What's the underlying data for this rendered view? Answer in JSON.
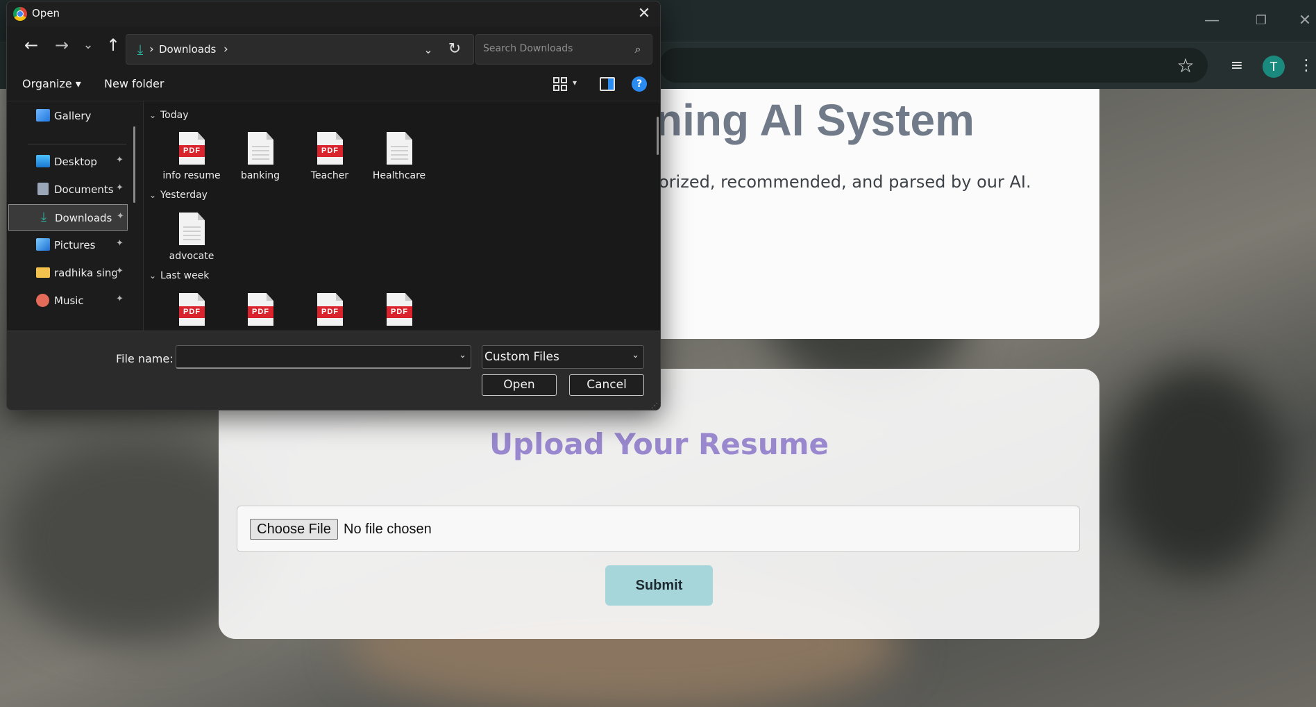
{
  "browser": {
    "window_controls": {
      "minimize": "—",
      "restore": "❐",
      "close": "✕"
    },
    "toolbar_icons": [
      "star-icon",
      "reading-list-icon",
      "profile-avatar",
      "menu-icon"
    ],
    "avatar_letter": "T",
    "avatar_color": "#1a8a7e"
  },
  "page": {
    "hero_title": "ning AI System",
    "hero_subtitle": "orized, recommended, and parsed by our AI.",
    "upload_title": "Upload Your Resume",
    "choose_file_label": "Choose File",
    "no_file_text": "No file chosen",
    "submit_label": "Submit",
    "colors": {
      "upload_title": "#9a88cf",
      "submit_bg": "#a6d6da",
      "hero_title": "#707a88"
    }
  },
  "dialog": {
    "title": "Open",
    "close_glyph": "✕",
    "nav": {
      "back": "←",
      "forward": "→",
      "recent": "⌄",
      "up": "↑"
    },
    "address": {
      "chevron": "›",
      "location": "Downloads",
      "refresh": "↻"
    },
    "search_placeholder": "Search Downloads",
    "commands": {
      "organize": "Organize ▾",
      "new_folder": "New folder",
      "help": "?"
    },
    "sidebar": [
      {
        "label": "Gallery",
        "icon": "gallery-icon",
        "pinned": false
      },
      {
        "label": "Desktop",
        "icon": "desktop-icon",
        "pinned": true
      },
      {
        "label": "Documents",
        "icon": "documents-icon",
        "pinned": true
      },
      {
        "label": "Downloads",
        "icon": "downloads-icon",
        "pinned": true,
        "selected": true
      },
      {
        "label": "Pictures",
        "icon": "pictures-icon",
        "pinned": true
      },
      {
        "label": "radhika singh",
        "icon": "folder-icon",
        "pinned": true
      },
      {
        "label": "Music",
        "icon": "music-icon",
        "pinned": true
      }
    ],
    "pin_glyph": "📌",
    "groups": [
      {
        "label": "Today",
        "files": [
          {
            "name": "info resume",
            "type": "pdf"
          },
          {
            "name": "banking",
            "type": "doc"
          },
          {
            "name": "Teacher",
            "type": "pdf"
          },
          {
            "name": "Healthcare",
            "type": "doc"
          }
        ]
      },
      {
        "label": "Yesterday",
        "files": [
          {
            "name": "advocate",
            "type": "doc"
          }
        ]
      },
      {
        "label": "Last week",
        "files": [
          {
            "name": "",
            "type": "pdf"
          },
          {
            "name": "",
            "type": "pdf"
          },
          {
            "name": "",
            "type": "pdf"
          },
          {
            "name": "",
            "type": "pdf"
          }
        ]
      }
    ],
    "pdf_badge": "PDF",
    "file_name_label": "File name:",
    "file_name_value": "",
    "file_type_filter": "Custom Files",
    "open_label": "Open",
    "cancel_label": "Cancel"
  }
}
